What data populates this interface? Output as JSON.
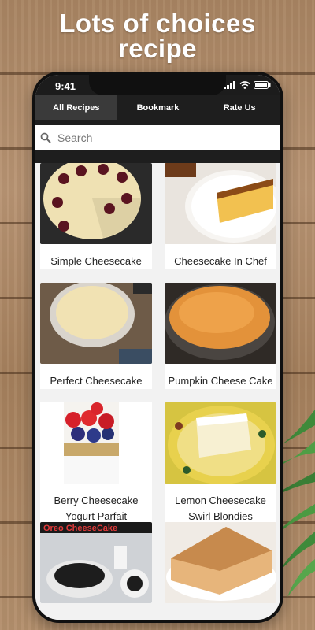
{
  "headline": {
    "line1": "Lots of choices",
    "line2": "recipe"
  },
  "status": {
    "time": "9:41"
  },
  "tabs": [
    {
      "label": "All Recipes",
      "active": true
    },
    {
      "label": "Bookmark",
      "active": false
    },
    {
      "label": "Rate Us",
      "active": false
    }
  ],
  "search": {
    "placeholder": "Search"
  },
  "recipes": [
    {
      "title": "Simple Cheesecake",
      "image": "cheesecake-with-berries"
    },
    {
      "title": "Cheesecake In Chef",
      "image": "flan-cheesecake-slice"
    },
    {
      "title": "Perfect Cheesecake",
      "image": "plain-round-cheesecake"
    },
    {
      "title": "Pumpkin Cheese Cake",
      "image": "golden-baked-cheesecake"
    },
    {
      "title": "Berry Cheesecake Yogurt Parfait",
      "image": "berry-parfait-jar"
    },
    {
      "title": "Lemon Cheesecake Swirl Blondies",
      "image": "lemon-blondie-plate"
    },
    {
      "title": "",
      "image": "oreo-cheesecake",
      "image_text": "Oreo CheeseCake"
    },
    {
      "title": "",
      "image": "sponge-cheesecake-slice"
    }
  ]
}
